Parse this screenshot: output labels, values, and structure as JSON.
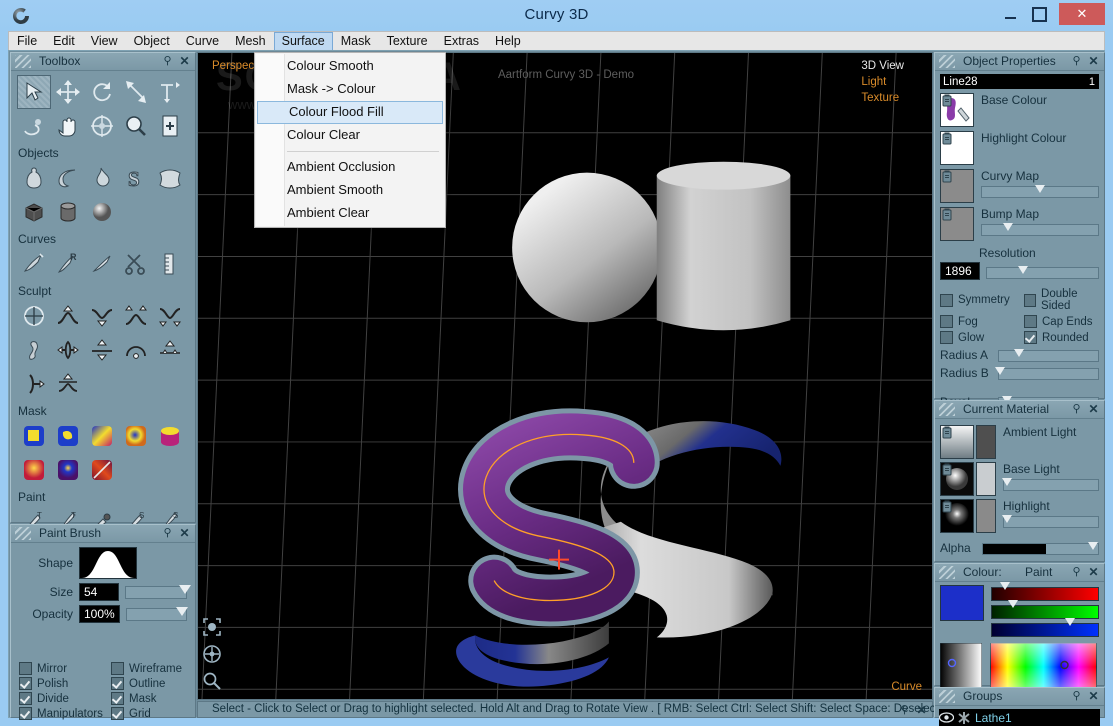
{
  "window": {
    "title": "Curvy 3D",
    "logo_icon": "curvy-logo-icon",
    "minimize_label": "Minimize",
    "maximize_label": "Maximize",
    "close_label": "Close"
  },
  "menubar": {
    "items": [
      {
        "label": "File",
        "active": false
      },
      {
        "label": "Edit",
        "active": false
      },
      {
        "label": "View",
        "active": false
      },
      {
        "label": "Object",
        "active": false
      },
      {
        "label": "Curve",
        "active": false
      },
      {
        "label": "Mesh",
        "active": false
      },
      {
        "label": "Surface",
        "active": true
      },
      {
        "label": "Mask",
        "active": false
      },
      {
        "label": "Texture",
        "active": false
      },
      {
        "label": "Extras",
        "active": false
      },
      {
        "label": "Help",
        "active": false
      }
    ]
  },
  "dropdown": {
    "open_menu": "Surface",
    "highlighted": "Colour Flood Fill",
    "items": [
      {
        "label": "Colour Smooth",
        "separator_after": false
      },
      {
        "label": "Mask -> Colour",
        "separator_after": false
      },
      {
        "label": "Colour Flood Fill",
        "separator_after": false
      },
      {
        "label": "Colour Clear",
        "separator_after": true
      },
      {
        "label": "Ambient Occlusion",
        "separator_after": false
      },
      {
        "label": "Ambient Smooth",
        "separator_after": false
      },
      {
        "label": "Ambient Clear",
        "separator_after": false
      }
    ]
  },
  "toolbox": {
    "title": "Toolbox",
    "pin_icon": "pin-icon",
    "close_icon": "close-icon",
    "sections": [
      {
        "label": "",
        "rows": [
          [
            "select-arrow-icon",
            "move-icon",
            "rotate-icon",
            "scale-icon",
            "move-axis-icon"
          ],
          [
            "lathe-spin-icon",
            "pan-hand-icon",
            "orbit-icon",
            "zoom-magnifier-icon",
            "new-page-icon"
          ]
        ]
      },
      {
        "label": "Objects",
        "rows": [
          [
            "lathe-object-icon",
            "curve-object-icon",
            "drip-object-icon",
            "text-object-icon",
            "plane-object-icon"
          ],
          [
            "cube-object-icon",
            "cylinder-object-icon",
            "sphere-object-icon"
          ]
        ]
      },
      {
        "label": "Curves",
        "rows": [
          [
            "draw-curve-icon",
            "revolve-curve-icon",
            "edit-curve-icon",
            "cut-curve-icon",
            "measure-icon"
          ]
        ]
      },
      {
        "label": "Sculpt",
        "rows": [
          [
            "inflate-icon",
            "raise-icon",
            "lower-icon",
            "expand-icon",
            "contract-icon"
          ],
          [
            "smudge-icon",
            "pinch-icon",
            "flatten-icon",
            "dome-icon",
            "bump-icon"
          ],
          [
            "crease-icon",
            "smooth-icon"
          ]
        ]
      },
      {
        "label": "Mask",
        "rows": [
          [
            "mask-box-icon",
            "mask-freehand-icon",
            "mask-gradient-icon",
            "mask-sphere-icon",
            "mask-fill-icon"
          ],
          [
            "mask-soften-icon",
            "mask-invert-icon",
            "mask-clear-icon"
          ]
        ]
      },
      {
        "label": "Paint",
        "rows": [
          [
            "paint-texture-brush-icon",
            "paint-texture-dot-icon",
            "paint-stamp-icon",
            "paint-surface-brush-icon",
            "paint-surface-dot-icon"
          ]
        ]
      }
    ]
  },
  "paintbrush": {
    "title": "Paint Brush",
    "shape_label": "Shape",
    "shape_preview": "bell-curve-brush-icon",
    "size_label": "Size",
    "size_value": "54",
    "size_percent": 88,
    "opacity_label": "Opacity",
    "opacity_value": "100%",
    "opacity_percent": 100,
    "checkboxes": [
      {
        "label": "Mirror",
        "checked": false
      },
      {
        "label": "Wireframe",
        "checked": false
      },
      {
        "label": "Polish",
        "checked": true
      },
      {
        "label": "Outline",
        "checked": true
      },
      {
        "label": "Divide",
        "checked": true
      },
      {
        "label": "Mask",
        "checked": true
      },
      {
        "label": "Manipulators",
        "checked": true
      },
      {
        "label": "Grid",
        "checked": true
      }
    ]
  },
  "viewport": {
    "perspective_label": "Perspective",
    "watermark_big": "SOFTPEDIA",
    "watermark_small": "www.softpedia.com",
    "scene_title": "Aartform Curvy 3D - Demo",
    "view_modes": [
      {
        "label": "3D View",
        "active": true
      },
      {
        "label": "Light",
        "active": false
      },
      {
        "label": "Texture",
        "active": false
      }
    ],
    "curve_label": "Curve",
    "nav_icons": [
      "frame-selection-icon",
      "orbit-view-icon",
      "zoom-view-icon"
    ],
    "colors": {
      "background": "#000000",
      "grid": "#4a4a4a",
      "s_purple": "#6b2d86",
      "s_outline": "#6e8a9c",
      "curve_orange": "#ffa028",
      "cursor_red": "#ff4b2b",
      "ribbon_blue": "#1e2f86",
      "ribbon_grey": "#b8b8b8",
      "solid_grey": "#b3b3b3"
    }
  },
  "statusbar": {
    "text": "Select - Click to Select or Drag to highlight selected. Hold Alt and Drag to Rotate View . [ RMB: Select    Ctrl: Select    Shift: Select    Space: Deselect"
  },
  "object_properties": {
    "title": "Object Properties",
    "object_name": "Line28",
    "object_index": "1",
    "maps": [
      {
        "label": "Base Colour",
        "thumb": "purple-paint-swatch-icon",
        "has_slider": false
      },
      {
        "label": "Highlight Colour",
        "thumb": "white-swatch-icon",
        "has_slider": false
      },
      {
        "label": "Curvy Map",
        "thumb": "grey-map-icon",
        "has_slider": true,
        "value": 50
      },
      {
        "label": "Bump Map",
        "thumb": "grey-map-icon",
        "has_slider": true,
        "value": 22
      }
    ],
    "resolution_label": "Resolution",
    "resolution_value": "1896",
    "resolution_percent": 32,
    "checkboxes": [
      {
        "label": "Symmetry",
        "checked": false
      },
      {
        "label": "Double Sided",
        "checked": false
      },
      {
        "label": "Fog",
        "checked": false
      },
      {
        "label": "Cap Ends",
        "checked": false
      },
      {
        "label": "Glow",
        "checked": false
      },
      {
        "label": "Rounded",
        "checked": true
      }
    ],
    "sliders": [
      {
        "label": "Radius A",
        "value": 20
      },
      {
        "label": "Radius B",
        "value": 1
      },
      {
        "label": "Bevel",
        "value": 8
      }
    ]
  },
  "current_material": {
    "title": "Current Material",
    "rows": [
      {
        "label": "Ambient Light",
        "thumb": "ambient-gradient-icon",
        "swatch": "#4f4f4f",
        "has_slider": false
      },
      {
        "label": "Base Light",
        "thumb": "base-sphere-icon",
        "swatch": "#c9cdd0",
        "has_slider": true,
        "value": 3
      },
      {
        "label": "Highlight",
        "thumb": "highlight-sphere-icon",
        "swatch": "#8a8a8a",
        "has_slider": true,
        "value": 3
      }
    ],
    "alpha_label": "Alpha",
    "alpha_percent": 55
  },
  "colour_panel": {
    "title_label": "Colour:",
    "mode_label": "Paint",
    "current_colour": "#1c2fc9",
    "channels": [
      {
        "name": "red",
        "value": 12
      },
      {
        "name": "green",
        "value": 20
      },
      {
        "name": "blue",
        "value": 74
      }
    ],
    "value_picker": "value-gradient-picker",
    "hue_picker": "hue-saturation-picker"
  },
  "groups": {
    "title": "Groups",
    "items": [
      {
        "label": "Lathe1",
        "visible_icon": "eye-icon",
        "type_icon": "asterisk-icon"
      }
    ]
  }
}
